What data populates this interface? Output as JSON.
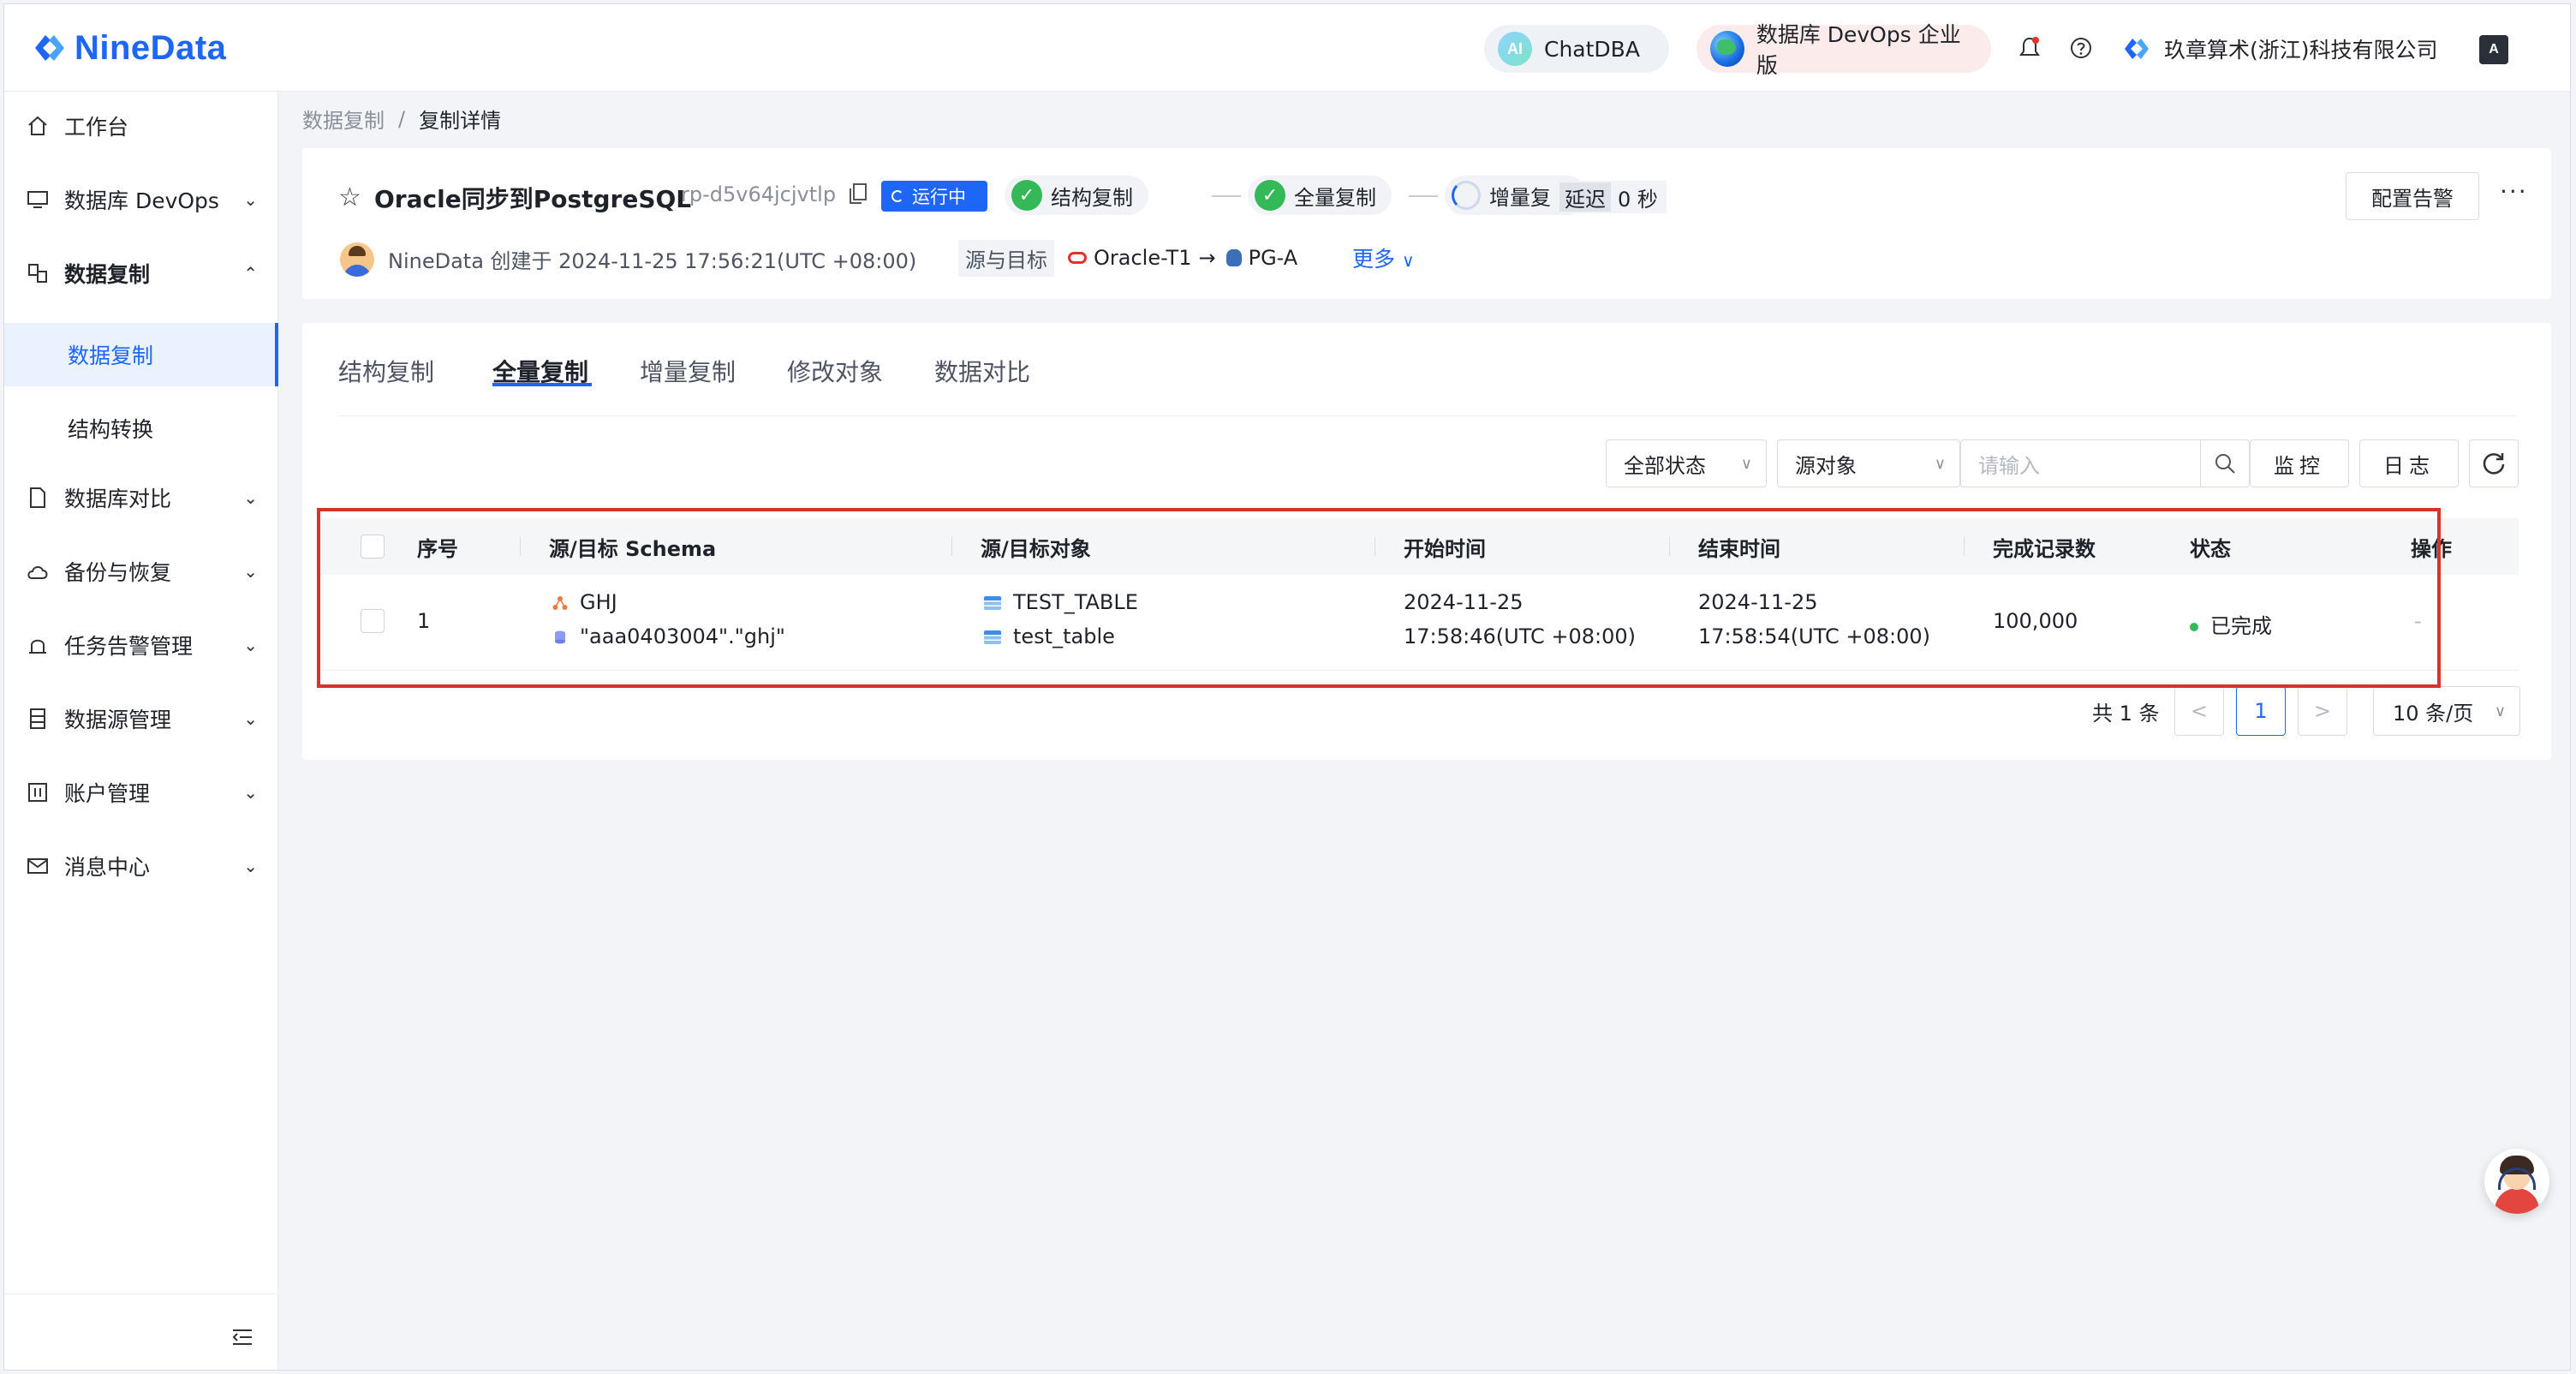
{
  "app": {
    "logo_text": "NineData",
    "brand_color": "#1e66f5"
  },
  "header": {
    "chatdba": "ChatDBA",
    "chatdba_badge": "AI",
    "devops_edition": "数据库 DevOps 企业版",
    "company": "玖章算术(浙江)科技有限公司",
    "icons": [
      "bell-icon",
      "help-icon",
      "language-icon"
    ]
  },
  "sidebar": {
    "items": [
      {
        "label": "工作台",
        "icon": "home-icon"
      },
      {
        "label": "数据库 DevOps",
        "icon": "sql-icon"
      },
      {
        "label": "数据复制",
        "icon": "replication-icon"
      },
      {
        "label": "数据库对比",
        "icon": "compare-icon"
      },
      {
        "label": "备份与恢复",
        "icon": "cloud-icon"
      },
      {
        "label": "任务告警管理",
        "icon": "alarm-icon"
      },
      {
        "label": "数据源管理",
        "icon": "datasource-icon"
      },
      {
        "label": "账户管理",
        "icon": "account-icon"
      },
      {
        "label": "消息中心",
        "icon": "mail-icon"
      }
    ],
    "sub_items": [
      "数据复制",
      "结构转换"
    ]
  },
  "breadcrumb": {
    "parent": "数据复制",
    "separator": "/",
    "current": "复制详情"
  },
  "task": {
    "title": "Oracle同步到PostgreSQL",
    "id": "rp-d5v64jcjvtlp",
    "status": "运行中",
    "steps": [
      "结构复制",
      "全量复制",
      "增量复制"
    ],
    "delay_label": "延迟",
    "delay_value": "0 秒",
    "creator_line": "NineData 创建于 2024-11-25 17:56:21(UTC +08:00)",
    "src_tgt_label": "源与目标",
    "source": "Oracle-T1",
    "arrow": "→",
    "target": "PG-A",
    "more": "更多",
    "alarm_button": "配置告警",
    "more_dots": "···"
  },
  "tabs": [
    "结构复制",
    "全量复制",
    "增量复制",
    "修改对象",
    "数据对比"
  ],
  "active_tab": "全量复制",
  "filters": {
    "status": "全部状态",
    "object": "源对象",
    "search_placeholder": "请输入",
    "monitor": "监控",
    "log": "日志"
  },
  "table": {
    "headers": [
      "序号",
      "源/目标 Schema",
      "源/目标对象",
      "开始时间",
      "结束时间",
      "完成记录数",
      "状态",
      "操作"
    ],
    "rows": [
      {
        "index": "1",
        "schema_src": "GHJ",
        "schema_tgt": "\"aaa0403004\".\"ghj\"",
        "object_src": "TEST_TABLE",
        "object_tgt": "test_table",
        "start_date": "2024-11-25",
        "start_time": "17:58:46(UTC +08:00)",
        "end_date": "2024-11-25",
        "end_time": "17:58:54(UTC +08:00)",
        "records": "100,000",
        "status": "已完成",
        "action": "-"
      }
    ]
  },
  "pagination": {
    "total": "共 1 条",
    "prev": "<",
    "current": "1",
    "next": ">",
    "page_size": "10 条/页"
  },
  "colors": {
    "success": "#35b857",
    "highlight": "#d9322b",
    "accent": "#1e66f5"
  }
}
